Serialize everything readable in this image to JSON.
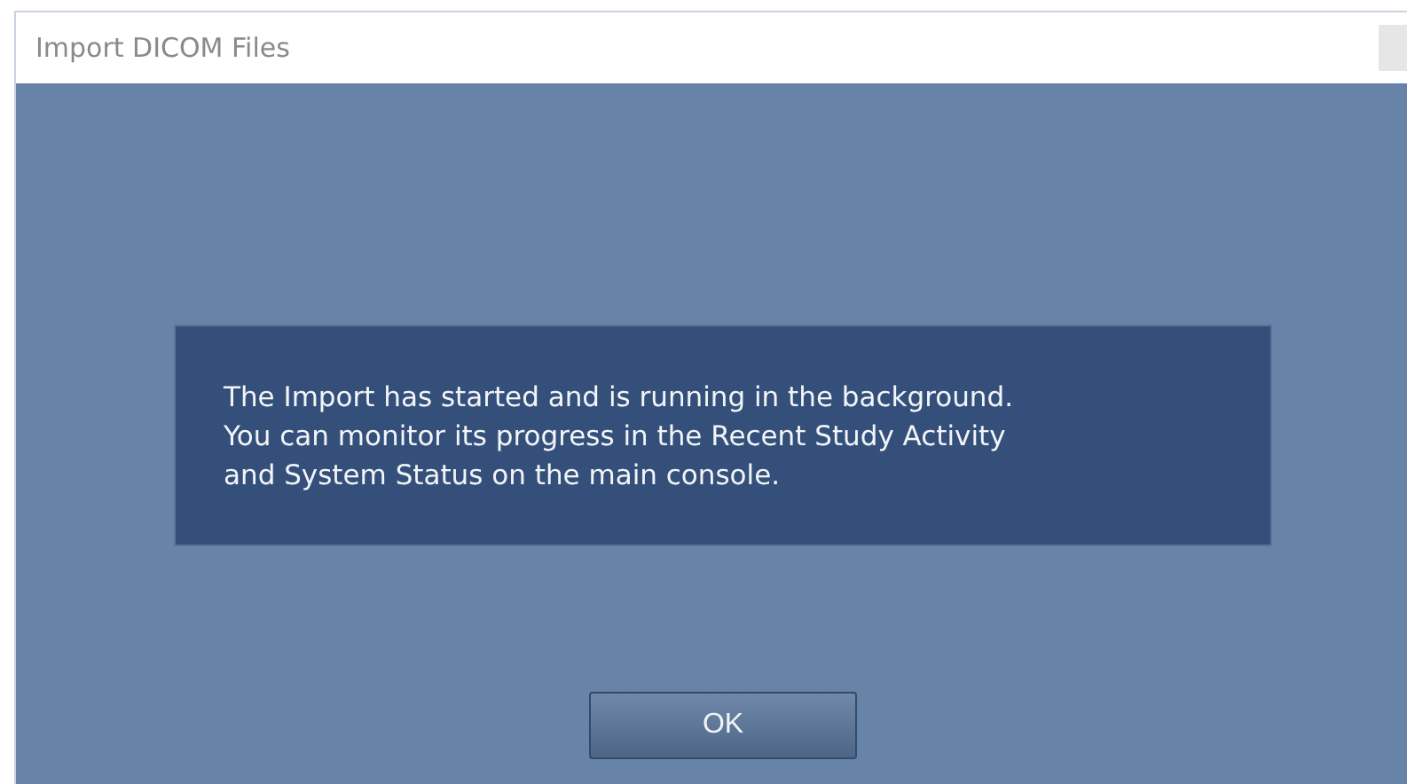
{
  "window": {
    "title": "Import DICOM Files"
  },
  "message": {
    "lines": [
      "The Import has started and is running in the background.",
      "You can monitor its progress in the Recent Study Activity",
      "and System Status on the main console."
    ]
  },
  "buttons": [
    {
      "label": "OK"
    }
  ]
}
